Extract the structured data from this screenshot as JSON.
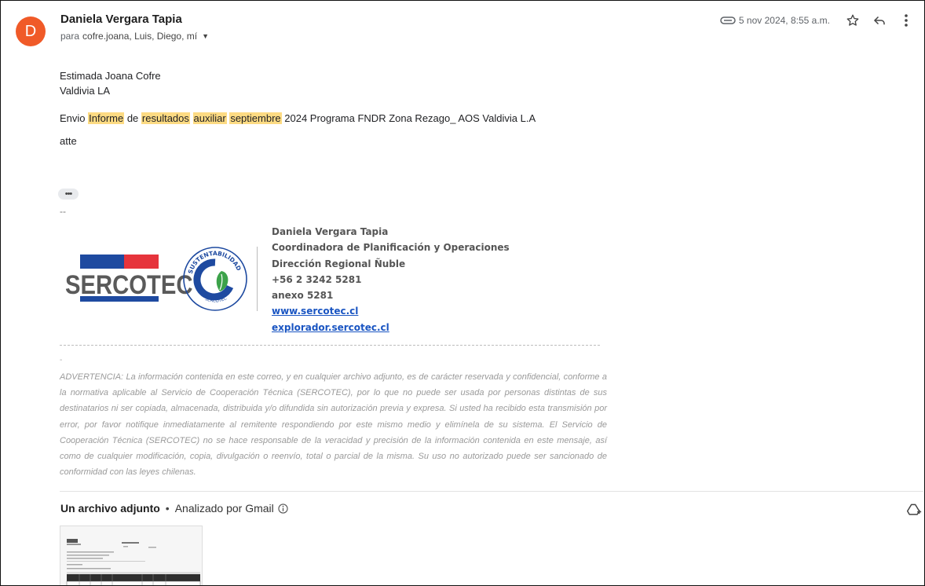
{
  "email": {
    "avatar_letter": "D",
    "sender_name": "Daniela Vergara Tapia",
    "recipients_prefix": "para",
    "recipients": "cofre.joana, Luis, Diego, mí",
    "date": "5 nov 2024, 8:55 a.m.",
    "body": {
      "greeting_line1": "Estimada Joana Cofre",
      "greeting_line2": "Valdivia LA",
      "message_parts": [
        "Envio ",
        "Informe",
        " de ",
        "resultados",
        " ",
        "auxiliar",
        " ",
        "septiembre",
        " 2024 Programa FNDR Zona Rezago_ AOS Valdivia L.A"
      ],
      "closing": "atte",
      "collapsed_indicator": "•••",
      "signature_dash": "--"
    }
  },
  "signature": {
    "logo_text": "SERCOTEC",
    "seal_top_text": "SUSTENTABILIDAD",
    "seal_bottom_text": "SERCOTEC",
    "name": "Daniela Vergara Tapia",
    "title": "Coordinadora de Planificación y Operaciones",
    "department": "Dirección Regional Ñuble",
    "phone": "+56 2 3242 5281",
    "extension": "anexo 5281",
    "link1": "www.sercotec.cl",
    "link2": "explorador.sercotec.cl"
  },
  "disclaimer": {
    "dash": "-",
    "text": "ADVERTENCIA: La información contenida en este correo, y en cualquier archivo adjunto, es de carácter reservada y confidencial, conforme a la normativa aplicable al Servicio de Cooperación Técnica (SERCOTEC), por lo que no puede ser usada por personas distintas de sus destinatarios ni ser copiada, almacenada, distribuida y/o difundida sin autorización previa y expresa. Si usted ha recibido esta transmisión por error, por favor notifique inmediatamente al remitente respondiendo por este mismo medio y elimínela de su sistema. El Servicio de Cooperación Técnica (SERCOTEC) no se hace responsable de la veracidad y precisión de la información contenida en este mensaje, así como de cualquier modificación, copia, divulgación o reenvío, total o parcial de la misma. Su uso no autorizado puede ser sancionado de conformidad con las leyes chilenas."
  },
  "attachments": {
    "count_label": "Un archivo adjunto",
    "separator": "•",
    "scanned_label": "Analizado por Gmail"
  },
  "colors": {
    "avatar": "#f05a28",
    "highlight": "#fddb83",
    "brand_blue": "#1e4aa0",
    "brand_red": "#e6343c",
    "link": "#1a55c2"
  },
  "icons": [
    "paperclip-icon",
    "star-icon",
    "reply-icon",
    "more-vert-icon",
    "info-icon",
    "add-to-drive-icon",
    "dropdown-caret-icon"
  ]
}
